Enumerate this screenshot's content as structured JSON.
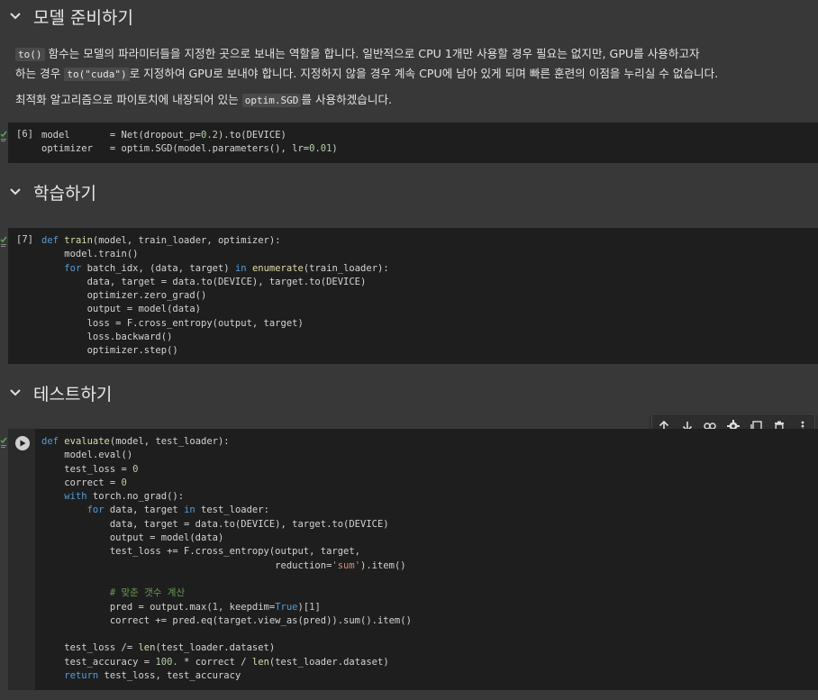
{
  "sections": {
    "prepare": {
      "title": "모델 준비하기"
    },
    "train": {
      "title": "학습하기"
    },
    "test": {
      "title": "테스트하기"
    }
  },
  "markdown": {
    "p1_code1": "to()",
    "p1_text1": " 함수는 모델의 파라미터들을 지정한 곳으로 보내는 역할을 합니다. 일반적으로 CPU 1개만 사용할 경우 필요는 없지만, GPU를 사용하고자",
    "p1_text2": "하는 경우 ",
    "p1_code2": "to(\"cuda\")",
    "p1_text3": "로 지정하여 GPU로 보내야 합니다. 지정하지 않을 경우 계속 CPU에 남아 있게 되며 빠른 훈련의 이점을 누리실 수 없습니다.",
    "p2_text1": "최적화 알고리즘으로 파이토치에 내장되어 있는 ",
    "p2_code": "optim.SGD",
    "p2_text2": "를 사용하겠습니다."
  },
  "cells": {
    "c6": {
      "count": "[6]"
    },
    "c7": {
      "count": "[7]"
    }
  },
  "toolbar": {
    "icons": [
      "arrow-up-icon",
      "arrow-down-icon",
      "link-icon",
      "gear-icon",
      "mirror-cell-icon",
      "trash-icon",
      "more-vert-icon"
    ]
  },
  "colors": {
    "background": "#383838",
    "cell_bg": "#1e1e1e",
    "keyword": "#569cd6",
    "function": "#dcdcaa",
    "string": "#ce9178",
    "comment": "#6a9955",
    "ok_check": "#4caf50"
  }
}
